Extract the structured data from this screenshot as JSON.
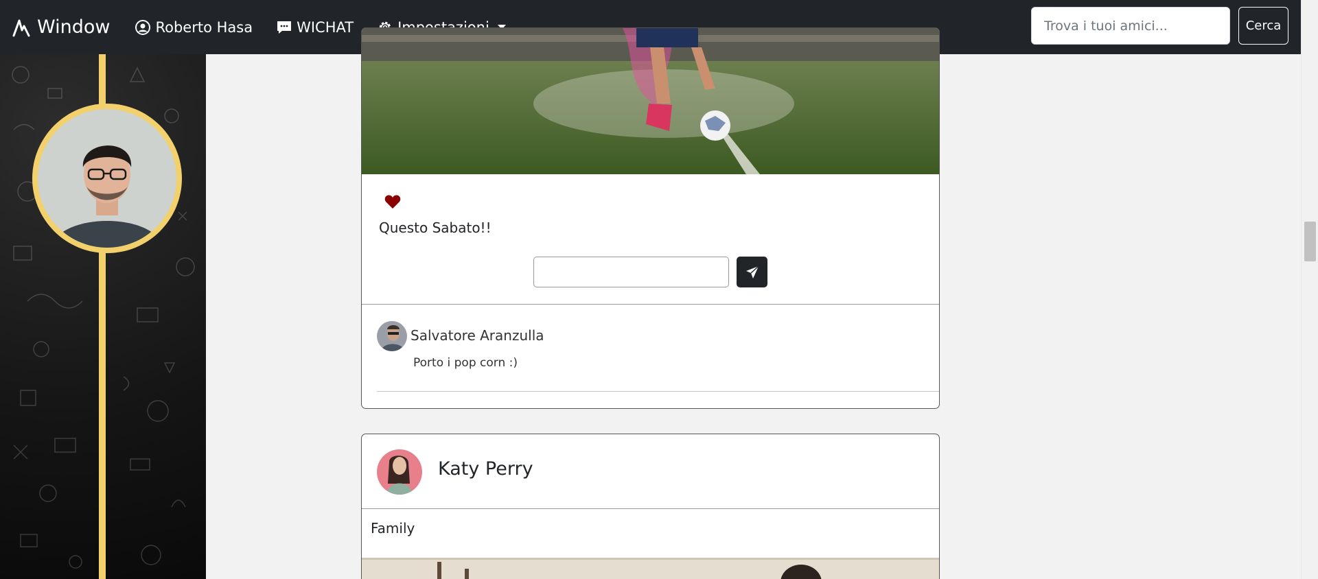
{
  "navbar": {
    "brand": "Window",
    "user_name": "Roberto Hasa",
    "chat_label": "WICHAT",
    "settings_label": "Impostazioni",
    "search_placeholder": "Trova i tuoi amici...",
    "search_button": "Cerca"
  },
  "sidebar": {
    "accent_color": "#f2d06b",
    "avatar_alt": "profile-avatar"
  },
  "posts": [
    {
      "caption": "Questo Sabato!!",
      "liked": true,
      "like_color": "#8b0000",
      "comment_input_value": "",
      "comments": [
        {
          "author": "Salvatore Aranzulla",
          "text": "Porto i pop corn :)"
        }
      ]
    },
    {
      "author": "Katy Perry",
      "category": "Family"
    }
  ]
}
